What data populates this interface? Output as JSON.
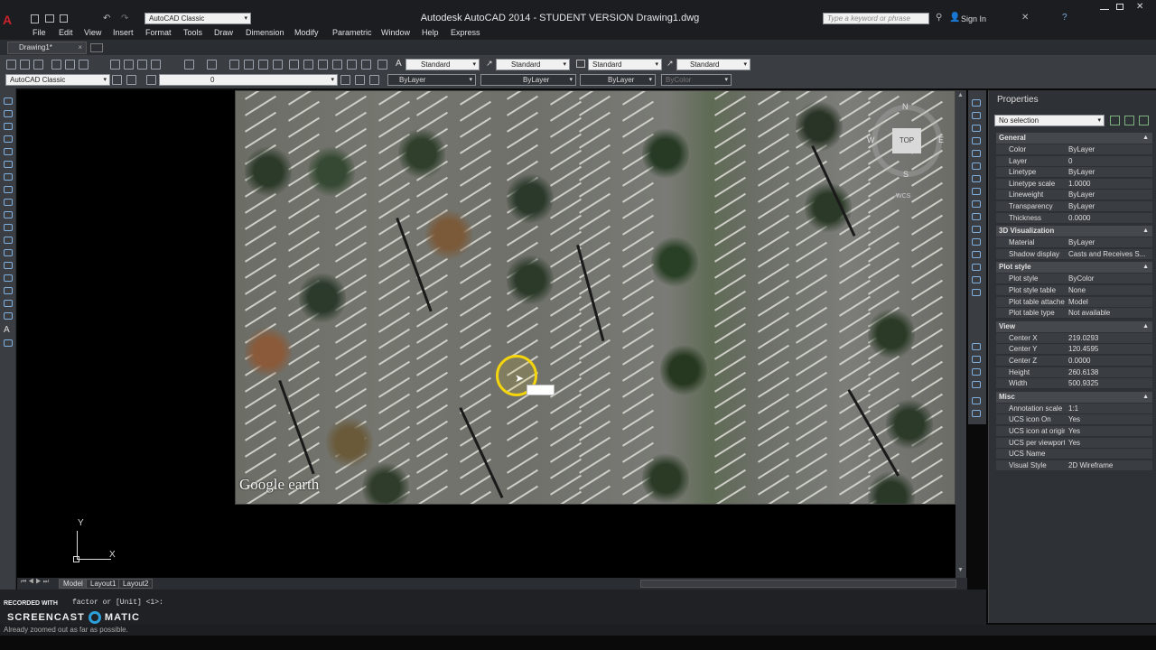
{
  "window": {
    "title": "Autodesk AutoCAD 2014 - STUDENT VERSION    Drawing1.dwg",
    "workspace_combo": "AutoCAD Classic",
    "search_placeholder": "Type a keyword or phrase",
    "sign_in": "Sign In"
  },
  "menu": [
    "File",
    "Edit",
    "View",
    "Insert",
    "Format",
    "Tools",
    "Draw",
    "Dimension",
    "Modify",
    "Parametric",
    "Window",
    "Help",
    "Express"
  ],
  "doc_tab": "Drawing1*",
  "styles": {
    "text_style": "Standard",
    "dim_style": "Standard",
    "table_style": "Standard",
    "mleader_style": "Standard"
  },
  "layers": {
    "workspace": "AutoCAD Classic",
    "current_layer": "0",
    "color": "ByLayer",
    "linetype": "ByLayer",
    "lineweight": "ByLayer",
    "plotstyle": "ByColor"
  },
  "viewcube": {
    "top": "TOP",
    "n": "N",
    "s": "S",
    "w": "W",
    "e": "E",
    "wcs": "WCS"
  },
  "ucs": {
    "x": "X",
    "y": "Y"
  },
  "photo_watermark": "Google earth",
  "layout_tabs": [
    "Model",
    "Layout1",
    "Layout2"
  ],
  "command": {
    "line1": "factor or [Unit] <1>:",
    "status": "Already zoomed out as far as possible."
  },
  "screencast": {
    "recorded": "RECORDED WITH",
    "brand": "SCREENCAST",
    "brand2": "MATIC"
  },
  "properties": {
    "title": "Properties",
    "selection": "No selection",
    "sections": [
      {
        "name": "General",
        "rows": [
          {
            "label": "Color",
            "value": "ByLayer"
          },
          {
            "label": "Layer",
            "value": "0"
          },
          {
            "label": "Linetype",
            "value": "ByLayer"
          },
          {
            "label": "Linetype scale",
            "value": "1.0000"
          },
          {
            "label": "Lineweight",
            "value": "ByLayer"
          },
          {
            "label": "Transparency",
            "value": "ByLayer"
          },
          {
            "label": "Thickness",
            "value": "0.0000"
          }
        ]
      },
      {
        "name": "3D Visualization",
        "rows": [
          {
            "label": "Material",
            "value": "ByLayer"
          },
          {
            "label": "Shadow display",
            "value": "Casts and Receives S..."
          }
        ]
      },
      {
        "name": "Plot style",
        "rows": [
          {
            "label": "Plot style",
            "value": "ByColor"
          },
          {
            "label": "Plot style table",
            "value": "None"
          },
          {
            "label": "Plot table attache...",
            "value": "Model"
          },
          {
            "label": "Plot table type",
            "value": "Not available"
          }
        ]
      },
      {
        "name": "View",
        "rows": [
          {
            "label": "Center X",
            "value": "219.0293"
          },
          {
            "label": "Center Y",
            "value": "120.4595"
          },
          {
            "label": "Center Z",
            "value": "0.0000"
          },
          {
            "label": "Height",
            "value": "260.6138"
          },
          {
            "label": "Width",
            "value": "500.9325"
          }
        ]
      },
      {
        "name": "Misc",
        "rows": [
          {
            "label": "Annotation scale",
            "value": "1:1"
          },
          {
            "label": "UCS icon On",
            "value": "Yes"
          },
          {
            "label": "UCS icon at origin",
            "value": "Yes"
          },
          {
            "label": "UCS per viewport",
            "value": "Yes"
          },
          {
            "label": "UCS Name",
            "value": ""
          },
          {
            "label": "Visual Style",
            "value": "2D Wireframe"
          }
        ]
      }
    ]
  },
  "colors": {
    "accent": "#c8222a",
    "highlight": "#f4d40d"
  }
}
